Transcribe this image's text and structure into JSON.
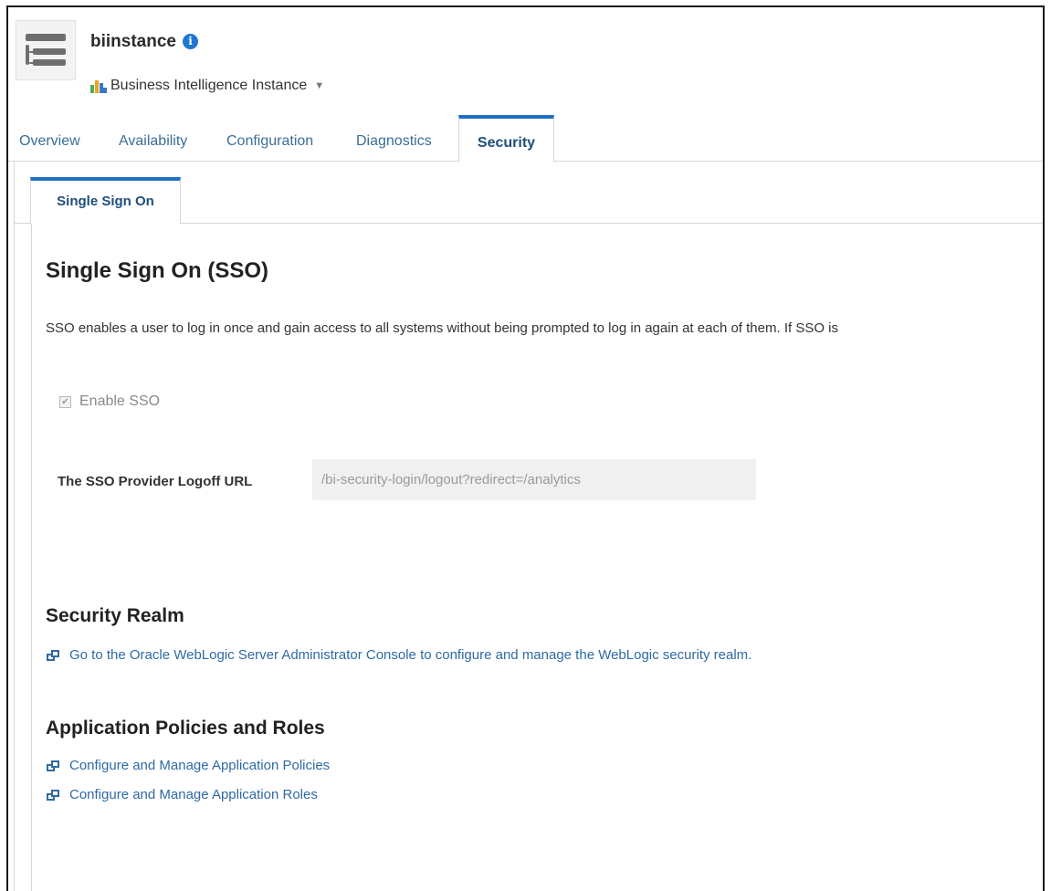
{
  "header": {
    "instance_name": "biinstance",
    "instance_type": "Business Intelligence Instance"
  },
  "main_tabs": [
    {
      "label": "Overview"
    },
    {
      "label": "Availability"
    },
    {
      "label": "Configuration"
    },
    {
      "label": "Diagnostics"
    },
    {
      "label": "Security",
      "active": true
    }
  ],
  "sub_tabs": [
    {
      "label": "Single Sign On",
      "active": true
    }
  ],
  "sso": {
    "title": "Single Sign On (SSO)",
    "description": "SSO enables a user to log in once and gain access to all systems without being prompted to log in again at each of them. If SSO is",
    "enable_label": "Enable SSO",
    "enable_checked": true,
    "logoff_label": "The SSO Provider Logoff URL",
    "logoff_value": "/bi-security-login/logout?redirect=/analytics"
  },
  "security_realm": {
    "title": "Security Realm",
    "link": "Go to the Oracle WebLogic Server Administrator Console to configure and manage the WebLogic security realm."
  },
  "app_policies": {
    "title": "Application Policies and Roles",
    "links": [
      "Configure and Manage Application Policies",
      "Configure and Manage Application Roles"
    ]
  },
  "colors": {
    "accent": "#1f6fc5",
    "link": "#2f6aa3",
    "info_icon": "#1f77d0"
  }
}
